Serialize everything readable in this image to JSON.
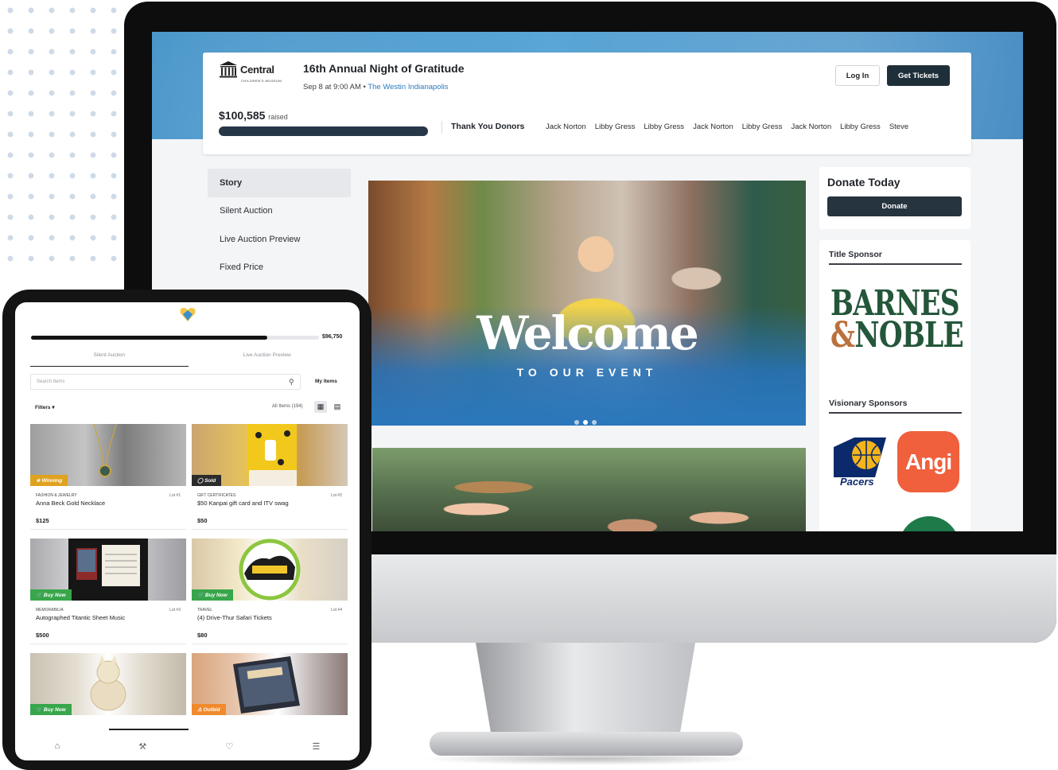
{
  "desktop": {
    "logo": {
      "text": "Central",
      "sub": "CHILDREN'S MUSEUM"
    },
    "event": {
      "title": "16th Annual Night of Gratitude",
      "date": "Sep 8 at 9:00 AM",
      "separator": "•",
      "venue": "The Westin Indianapolis"
    },
    "header_buttons": {
      "login": "Log In",
      "tickets": "Get Tickets"
    },
    "raised": {
      "amount": "$100,585",
      "label": "raised",
      "progress": 1.0
    },
    "donors": {
      "label": "Thank You Donors",
      "names": [
        "Jack Norton",
        "Libby Gress",
        "Libby Gress",
        "Jack Norton",
        "Libby Gress",
        "Jack Norton",
        "Libby Gress",
        "Steve"
      ]
    },
    "nav": [
      "Story",
      "Silent Auction",
      "Live Auction Preview",
      "Fixed Price"
    ],
    "banner": {
      "title": "Welcome",
      "subtitle": "TO OUR EVENT",
      "slide_count": 3,
      "active_slide": 2
    },
    "donate": {
      "title": "Donate Today",
      "button": "Donate"
    },
    "sponsors": {
      "title_label": "Title Sponsor",
      "title_sponsor": {
        "line1": "BARNES",
        "amp": "&",
        "line2": "NOBLE"
      },
      "visionary_label": "Visionary Sponsors",
      "visionary": [
        {
          "name": "Pacers"
        },
        {
          "name": "Angi"
        }
      ]
    }
  },
  "tablet": {
    "raised_amount": "$96,750",
    "progress": 0.82,
    "tabs": [
      "Silent Auction",
      "Live Auction Preview"
    ],
    "search_placeholder": "Search Items",
    "my_items": "My Items",
    "filters": "Filters",
    "all_items": "All Items (194)",
    "items": [
      {
        "badge": "Winning",
        "badge_color": "#e0a21e",
        "badge_icon": "trophy-icon",
        "category": "FASHION & JEWELRY",
        "lot": "Lot #1",
        "name": "Anna Beck Gold Necklace",
        "price": "$125"
      },
      {
        "badge": "Sold",
        "badge_color": "#2b2b2b",
        "badge_icon": "tag-icon",
        "category": "GIFT CERTIFICATES",
        "lot": "Lot #2",
        "name": "$50 Kanpai gift card and ITV swag",
        "price": "$50"
      },
      {
        "badge": "Buy Now",
        "badge_color": "#38a64a",
        "badge_icon": "cart-icon",
        "category": "MEMORABILIA",
        "lot": "Lot #3",
        "name": "Autographed Titantic Sheet Music",
        "price": "$500"
      },
      {
        "badge": "Buy Now",
        "badge_color": "#38a64a",
        "badge_icon": "cart-icon",
        "category": "TRAVEL",
        "lot": "Lot #4",
        "name": "(4) Drive-Thur Safari Tickets",
        "price": "$80"
      },
      {
        "badge": "Buy Now",
        "badge_color": "#38a64a",
        "badge_icon": "cart-icon",
        "category": "",
        "lot": "",
        "name": "",
        "price": ""
      },
      {
        "badge": "Outbid",
        "badge_color": "#f08a2c",
        "badge_icon": "alert-icon",
        "category": "",
        "lot": "",
        "name": "",
        "price": ""
      }
    ],
    "bottom_nav": [
      "home-icon",
      "gavel-icon",
      "donate-icon",
      "menu-icon"
    ]
  }
}
